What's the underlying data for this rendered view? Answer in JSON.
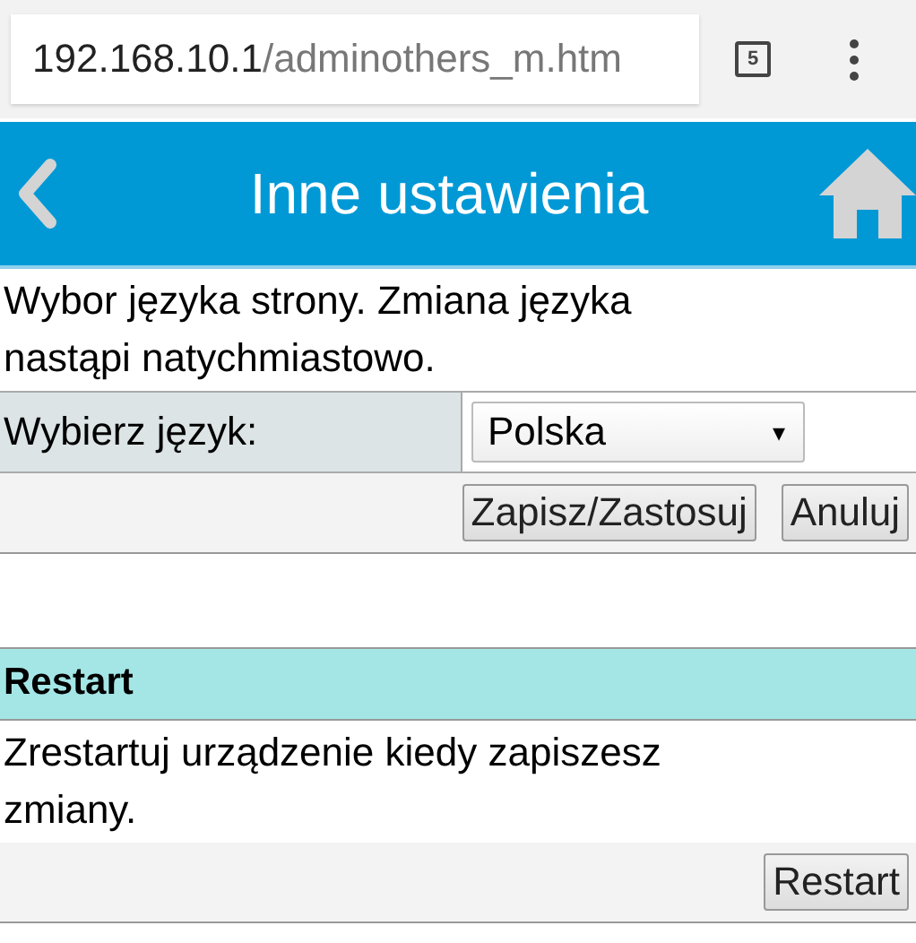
{
  "address_bar": {
    "host": "192.168.10.1",
    "path": "/adminothers_m.htm",
    "tab_count": "5"
  },
  "header": {
    "title": "Inne ustawienia"
  },
  "sections": [
    {
      "description": "Wybor języka strony. Zmiana języka nastąpi natychmiastowo.",
      "field": {
        "label": "Wybierz język:",
        "value": "Polska",
        "arrow": "▾"
      },
      "buttons": [
        "Zapisz/Zastosuj",
        "Anuluj"
      ]
    },
    {
      "heading": "Restart",
      "description": "Zrestartuj urządzenie kiedy zapiszesz zmiany.",
      "buttons": [
        "Restart"
      ]
    }
  ]
}
